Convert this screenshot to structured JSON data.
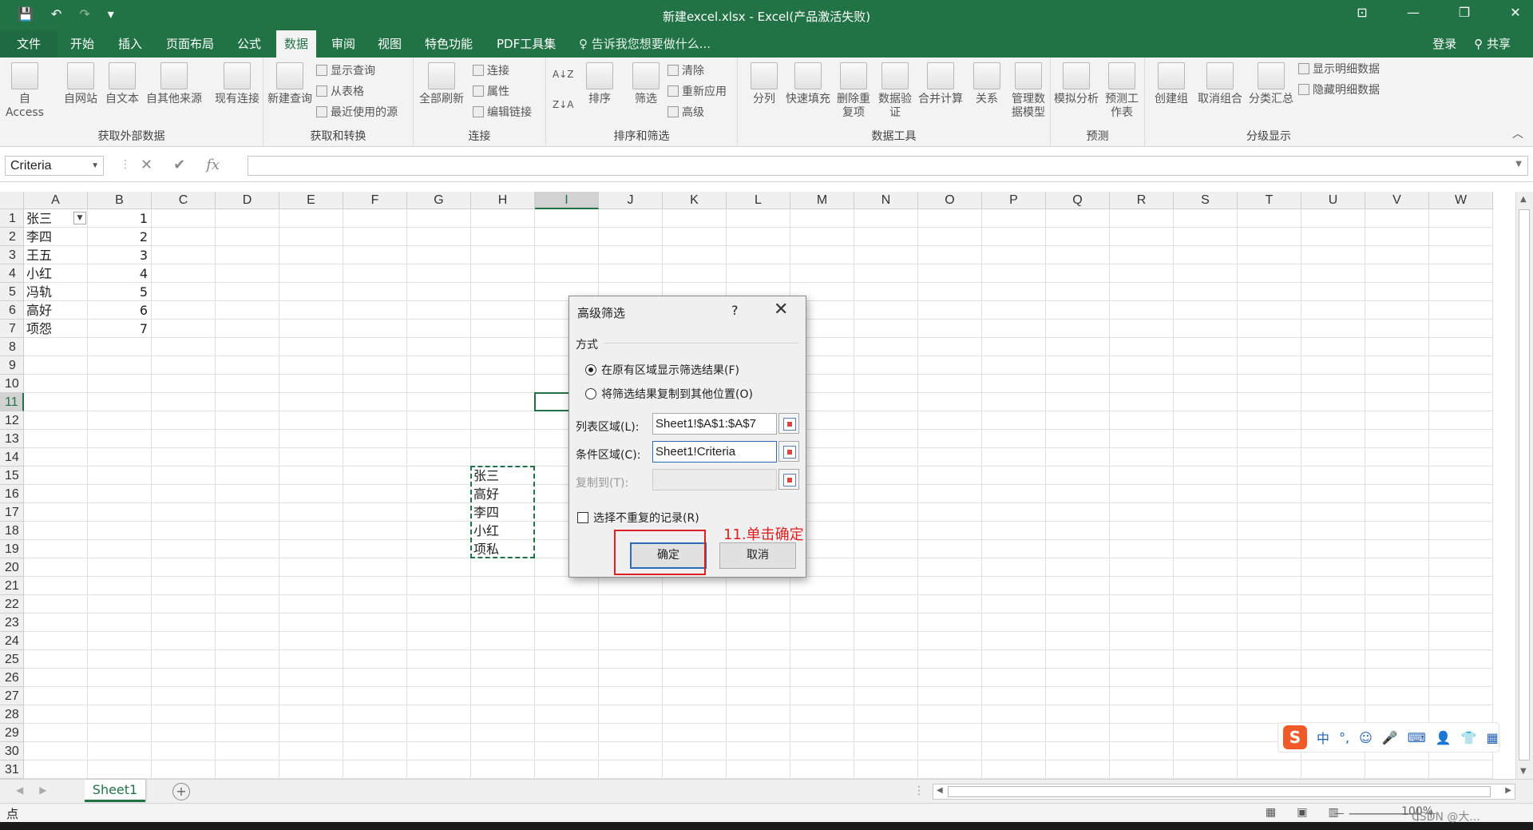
{
  "window": {
    "title": "新建excel.xlsx - Excel(产品激活失败)",
    "controls": [
      "restore-ribbon",
      "minimize",
      "maximize",
      "close"
    ]
  },
  "qat": {
    "save": "💾",
    "undo": "↶",
    "redo": "↷",
    "more": "▾"
  },
  "tabs": [
    {
      "label": "文件"
    },
    {
      "label": "开始"
    },
    {
      "label": "插入"
    },
    {
      "label": "页面布局"
    },
    {
      "label": "公式"
    },
    {
      "label": "数据"
    },
    {
      "label": "审阅"
    },
    {
      "label": "视图"
    },
    {
      "label": "特色功能"
    },
    {
      "label": "PDF工具集"
    }
  ],
  "tell_me": "♀ 告诉我您想要做什么...",
  "account": {
    "login": "登录",
    "share": "共享"
  },
  "ribbon": {
    "groups": [
      {
        "label": "获取外部数据",
        "buttons": [
          "自 Access",
          "自网站",
          "自文本",
          "自其他来源",
          "现有连接"
        ]
      },
      {
        "label": "获取和转换",
        "buttons": [
          "新建查询"
        ],
        "small": [
          "显示查询",
          "从表格",
          "最近使用的源"
        ]
      },
      {
        "label": "连接",
        "buttons": [
          "全部刷新"
        ],
        "small": [
          "连接",
          "属性",
          "编辑链接"
        ]
      },
      {
        "label": "排序和筛选",
        "buttons": [
          "排序",
          "筛选"
        ],
        "small": [
          "清除",
          "重新应用",
          "高级"
        ]
      },
      {
        "label": "数据工具",
        "buttons": [
          "分列",
          "快速填充",
          "删除重复项",
          "数据验证",
          "合并计算",
          "关系",
          "管理数据模型"
        ]
      },
      {
        "label": "预测",
        "buttons": [
          "模拟分析",
          "预测工作表"
        ]
      },
      {
        "label": "分级显示",
        "buttons": [
          "创建组",
          "取消组合",
          "分类汇总"
        ],
        "small": [
          "显示明细数据",
          "隐藏明细数据"
        ]
      }
    ]
  },
  "formula_bar": {
    "name_box": "Criteria",
    "cancel": "✕",
    "enter": "✔",
    "fx": "fx",
    "value": ""
  },
  "columns": [
    "A",
    "B",
    "C",
    "D",
    "E",
    "F",
    "G",
    "H",
    "I",
    "J",
    "K",
    "L",
    "M",
    "N",
    "O",
    "P",
    "Q",
    "R",
    "S",
    "T",
    "U",
    "V",
    "W"
  ],
  "rows": [
    "1",
    "2",
    "3",
    "4",
    "5",
    "6",
    "7",
    "8",
    "9",
    "10",
    "11",
    "12",
    "13",
    "14",
    "15",
    "16",
    "17",
    "18",
    "19",
    "20",
    "21",
    "22",
    "23",
    "24",
    "25",
    "26",
    "27",
    "28",
    "29",
    "30",
    "31"
  ],
  "sheet": {
    "colA": [
      "张三",
      "李四",
      "王五",
      "小红",
      "冯轨",
      "高好",
      "项怨"
    ],
    "colB": [
      "1",
      "2",
      "3",
      "4",
      "5",
      "6",
      "7"
    ],
    "colH": [
      "张三",
      "高好",
      "李四",
      "小红",
      "项私"
    ]
  },
  "sheet_tabs": {
    "active": "Sheet1",
    "add": "+"
  },
  "status": {
    "mode": "点",
    "zoom": "100%"
  },
  "dialog": {
    "title": "高级筛选",
    "help": "?",
    "close": "✕",
    "section": "方式",
    "option1": "在原有区域显示筛选结果(F)",
    "option2": "将筛选结果复制到其他位置(O)",
    "list_label": "列表区域(L):",
    "list_value": "Sheet1!$A$1:$A$7",
    "criteria_label": "条件区域(C):",
    "criteria_value": "Sheet1!Criteria",
    "copy_label": "复制到(T):",
    "copy_value": "",
    "unique_label": "选择不重复的记录(R)",
    "ok": "确定",
    "cancel": "取消"
  },
  "annotation": "11.单击确定",
  "ime": {
    "logo": "S",
    "items": [
      "中",
      "°,",
      "☺",
      "🎤",
      "⌨",
      "👤",
      "👕",
      "▦"
    ]
  },
  "watermark": "CSDN @大..."
}
